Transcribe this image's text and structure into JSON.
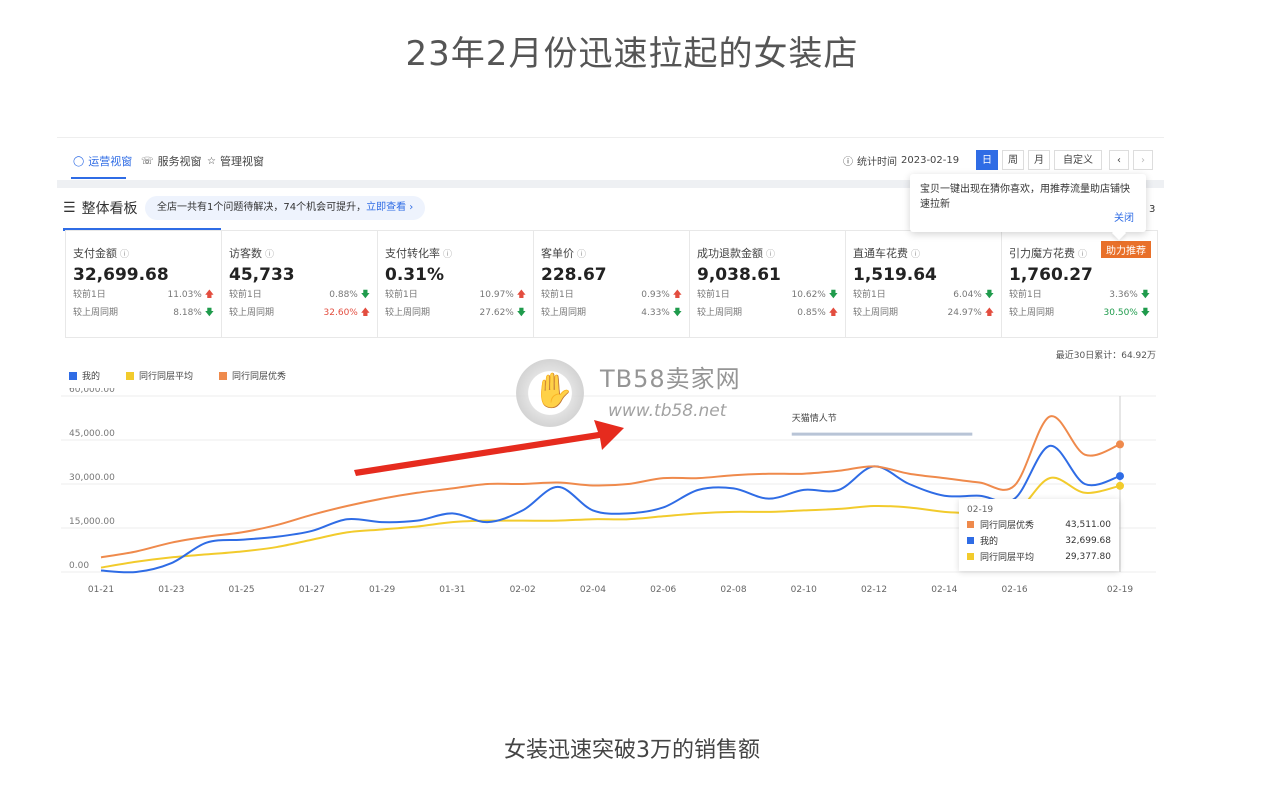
{
  "page": {
    "title": "23年2月份迅速拉起的女装店",
    "caption": "女装迅速突破3万的销售额"
  },
  "toolbar": {
    "tabs": [
      {
        "label": "运营视窗",
        "icon": "shield-icon"
      },
      {
        "label": "服务视窗",
        "icon": "headset-icon"
      },
      {
        "label": "管理视窗",
        "icon": "trophy-icon"
      }
    ],
    "stat_time_label": "统计时间",
    "stat_time_value": "2023-02-19",
    "period_buttons": [
      "日",
      "周",
      "月",
      "自定义"
    ],
    "prev": "‹",
    "next": "›"
  },
  "overview": {
    "title": "整体看板",
    "banner_text": "全店一共有1个问题待解决，74个机会可提升，",
    "banner_link": "立即查看",
    "tip_text": "宝贝一键出现在猜你喜欢，用推荐流量助店铺快速拉新",
    "tip_close": "关闭",
    "tip_tail": "3"
  },
  "metrics": [
    {
      "label": "支付金额",
      "value": "32,699.68",
      "d1_label": "较前1日",
      "d1": "11.03%",
      "d1_dir": "up",
      "wk_label": "较上周同期",
      "wk": "8.18%",
      "wk_dir": "down"
    },
    {
      "label": "访客数",
      "value": "45,733",
      "d1_label": "较前1日",
      "d1": "0.88%",
      "d1_dir": "down",
      "wk_label": "较上周同期",
      "wk": "32.60%",
      "wk_dir": "up"
    },
    {
      "label": "支付转化率",
      "value": "0.31%",
      "d1_label": "较前1日",
      "d1": "10.97%",
      "d1_dir": "up",
      "wk_label": "较上周同期",
      "wk": "27.62%",
      "wk_dir": "down"
    },
    {
      "label": "客单价",
      "value": "228.67",
      "d1_label": "较前1日",
      "d1": "0.93%",
      "d1_dir": "up",
      "wk_label": "较上周同期",
      "wk": "4.33%",
      "wk_dir": "down"
    },
    {
      "label": "成功退款金额",
      "value": "9,038.61",
      "d1_label": "较前1日",
      "d1": "10.62%",
      "d1_dir": "down",
      "wk_label": "较上周同期",
      "wk": "0.85%",
      "wk_dir": "up"
    },
    {
      "label": "直通车花费",
      "value": "1,519.64",
      "d1_label": "较前1日",
      "d1": "6.04%",
      "d1_dir": "down",
      "wk_label": "较上周同期",
      "wk": "24.97%",
      "wk_dir": "up"
    },
    {
      "label": "引力魔方花费",
      "value": "1,760.27",
      "d1_label": "较前1日",
      "d1": "3.36%",
      "d1_dir": "down",
      "wk_label": "较上周同期",
      "wk": "30.50%",
      "wk_dir": "down",
      "badge": "助力推荐"
    }
  ],
  "rolling_total": "最近30日累计：64.92万",
  "watermark": {
    "name": "TB58卖家网",
    "url": "www.tb58.net"
  },
  "colors": {
    "accent": "#2f6ce5",
    "mine": "#2f6ce5",
    "avg": "#f2cb2c",
    "best": "#ef8a4c",
    "arrow": "#e62b1e"
  },
  "chart_data": {
    "type": "line",
    "x": [
      "01-21",
      "01-22",
      "01-23",
      "01-24",
      "01-25",
      "01-26",
      "01-27",
      "01-28",
      "01-29",
      "01-30",
      "01-31",
      "02-01",
      "02-02",
      "02-03",
      "02-04",
      "02-05",
      "02-06",
      "02-07",
      "02-08",
      "02-09",
      "02-10",
      "02-11",
      "02-12",
      "02-13",
      "02-14",
      "02-15",
      "02-16",
      "02-17",
      "02-18",
      "02-19"
    ],
    "x_ticks": [
      "01-21",
      "01-23",
      "01-25",
      "01-27",
      "01-29",
      "01-31",
      "02-02",
      "02-04",
      "02-06",
      "02-08",
      "02-10",
      "02-12",
      "02-14",
      "02-16",
      "02-19"
    ],
    "ylim": [
      0,
      60000
    ],
    "y_ticks": [
      "0.00",
      "15,000.00",
      "30,000.00",
      "45,000.00",
      "60,000.00"
    ],
    "series": [
      {
        "name": "我的",
        "color": "#2f6ce5",
        "values": [
          500,
          0,
          3000,
          10000,
          11000,
          12000,
          14000,
          18000,
          17000,
          17500,
          20000,
          17000,
          21000,
          29000,
          21000,
          20000,
          22000,
          28000,
          28500,
          25000,
          28000,
          28000,
          36000,
          30000,
          26000,
          26000,
          25000,
          43000,
          30000,
          32699.68
        ]
      },
      {
        "name": "同行同层平均",
        "color": "#f2cb2c",
        "values": [
          1500,
          3500,
          5000,
          6000,
          7000,
          8500,
          11000,
          13500,
          14500,
          15500,
          17000,
          17500,
          17500,
          17500,
          18000,
          18000,
          19000,
          20000,
          20500,
          20500,
          21000,
          21500,
          22500,
          22000,
          20500,
          20000,
          20000,
          32000,
          27000,
          29377.8
        ]
      },
      {
        "name": "同行同层优秀",
        "color": "#ef8a4c",
        "values": [
          5000,
          7000,
          10000,
          12000,
          13500,
          16000,
          19500,
          22500,
          25000,
          27000,
          28500,
          30000,
          30000,
          30500,
          29500,
          30000,
          32000,
          32000,
          33000,
          33500,
          33500,
          34500,
          36000,
          33500,
          32000,
          30500,
          29500,
          53000,
          40000,
          43511.0
        ]
      }
    ],
    "annotation": "天猫情人节",
    "tooltip": {
      "date": "02-19",
      "rows": [
        {
          "name": "同行同层优秀",
          "value": "43,511.00",
          "color": "#ef8a4c"
        },
        {
          "name": "我的",
          "value": "32,699.68",
          "color": "#2f6ce5"
        },
        {
          "name": "同行同层平均",
          "value": "29,377.80",
          "color": "#f2cb2c"
        }
      ]
    }
  }
}
